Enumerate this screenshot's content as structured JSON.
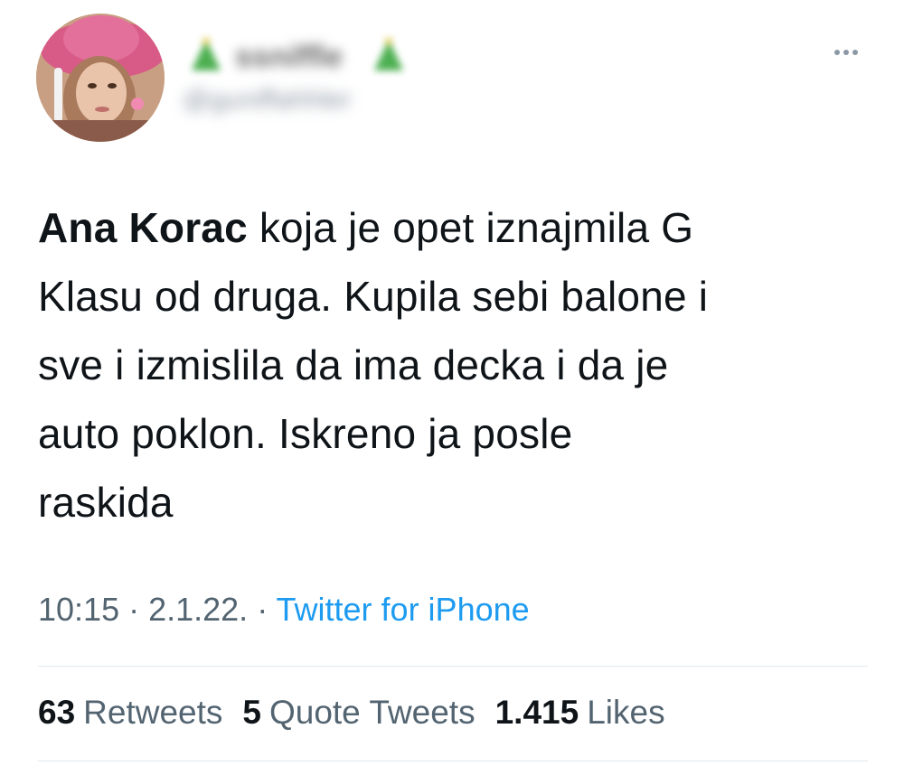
{
  "tweet": {
    "author": {
      "display_name": "ssniffle",
      "handle": "@guniffahhler"
    },
    "text": {
      "mention": "Ana Korac",
      "lines": [
        " koja je opet iznajmila G",
        "Klasu od druga. Kupila sebi balone i",
        "sve i izmislila da ima decka i da je",
        "auto poklon. Iskreno ja posle",
        "raskida"
      ]
    },
    "meta": {
      "time": "10:15",
      "separator": " · ",
      "date": "2.1.22.",
      "source": "Twitter for iPhone"
    },
    "stats": [
      {
        "count": "63",
        "label": "Retweets"
      },
      {
        "count": "5",
        "label": "Quote Tweets"
      },
      {
        "count": "1.415",
        "label": "Likes"
      }
    ]
  },
  "icons": {
    "more": "more-horizontal-icon",
    "emoji": "green-emoji-icon"
  },
  "colors": {
    "text": "#0f1419",
    "secondary": "#536471",
    "link": "#1d9bf0",
    "divider": "#e1e8ed"
  }
}
